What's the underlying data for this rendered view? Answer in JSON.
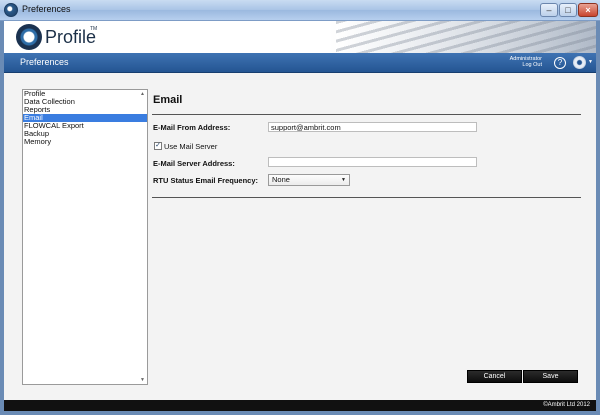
{
  "window": {
    "title": "Preferences",
    "controls": {
      "minimize": "–",
      "maximize": "□",
      "close": "×"
    }
  },
  "header": {
    "logo_text": "Profile",
    "logo_tm": "TM"
  },
  "navbar": {
    "section_title": "Preferences",
    "user_name": "Administrator",
    "logout_label": "Log Out",
    "help_glyph": "?",
    "menu_caret": "▼"
  },
  "sidebar": {
    "items": [
      {
        "label": "Profile",
        "selected": false
      },
      {
        "label": "Data Collection",
        "selected": false
      },
      {
        "label": "Reports",
        "selected": false
      },
      {
        "label": "Email",
        "selected": true
      },
      {
        "label": "FLOWCAL Export",
        "selected": false
      },
      {
        "label": "Backup",
        "selected": false
      },
      {
        "label": "Memory",
        "selected": false
      }
    ],
    "scroll_up_glyph": "▲",
    "scroll_down_glyph": "▼"
  },
  "email_panel": {
    "title": "Email",
    "from_address_label": "E-Mail From Address:",
    "from_address_value": "support@ambrit.com",
    "use_mail_server_label": "Use Mail Server",
    "use_mail_server_checked": true,
    "checkbox_glyph": "✓",
    "server_address_label": "E-Mail Server Address:",
    "server_address_value": "",
    "rtu_frequency_label": "RTU Status Email Frequency:",
    "rtu_frequency_selected": "None",
    "select_caret": "▼"
  },
  "actions": {
    "cancel_label": "Cancel",
    "save_label": "Save"
  },
  "footer": {
    "copyright": "©Ambrit Ltd 2012"
  },
  "colors": {
    "accent_nav": "#245592",
    "selection": "#3a7de0",
    "button_bg": "#111111"
  }
}
